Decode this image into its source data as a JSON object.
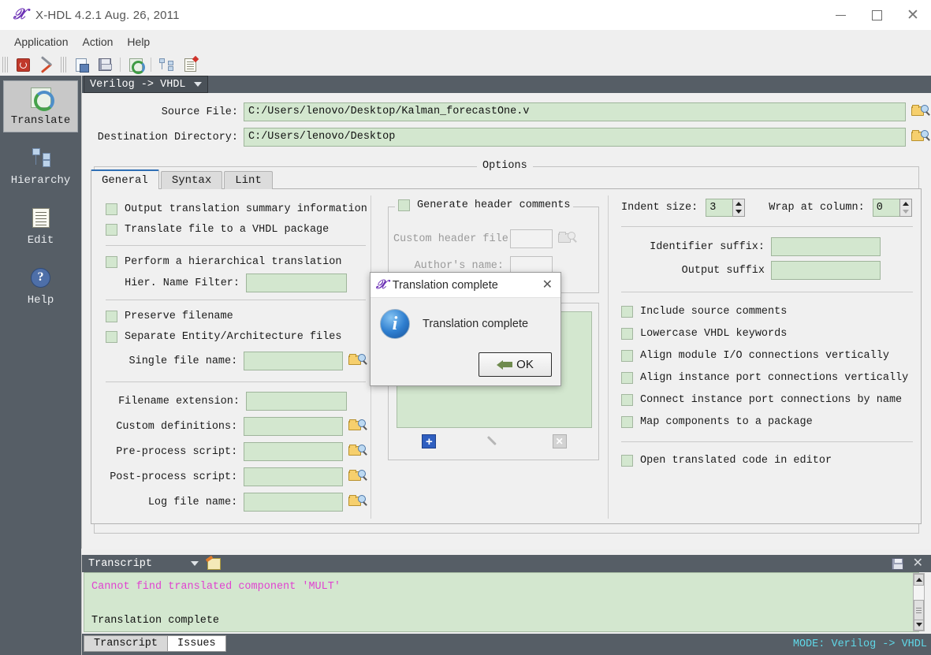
{
  "window": {
    "title": "X-HDL 4.2.1  Aug. 26, 2011",
    "app_icon": "x-hdl-logo-icon",
    "minimize": "minimize-icon",
    "maximize": "maximize-icon",
    "close": "close-icon"
  },
  "menubar": {
    "items": [
      "Application",
      "Action",
      "Help"
    ]
  },
  "toolbar": {
    "icons": [
      "exit-icon",
      "tools-icon",
      "save-as-icon",
      "save-icon",
      "translate-icon",
      "hierarchy-icon",
      "edit-icon"
    ]
  },
  "sidebar": {
    "items": [
      {
        "label": "Translate",
        "icon": "translate-icon",
        "selected": true
      },
      {
        "label": "Hierarchy",
        "icon": "hierarchy-icon",
        "selected": false
      },
      {
        "label": "Edit",
        "icon": "edit-icon",
        "selected": false
      },
      {
        "label": "Help",
        "icon": "help-icon",
        "selected": false
      }
    ]
  },
  "mode_selector": {
    "value": "Verilog -> VHDL"
  },
  "paths": {
    "source_label": "Source File:",
    "source_value": "C:/Users/lenovo/Desktop/Kalman_forecastOne.v",
    "dest_label": "Destination Directory:",
    "dest_value": "C:/Users/lenovo/Desktop"
  },
  "options": {
    "group_title": "Options",
    "tabs": [
      {
        "label": "General",
        "active": true
      },
      {
        "label": "Syntax",
        "active": false
      },
      {
        "label": "Lint",
        "active": false
      }
    ],
    "left_column": {
      "checks_top": [
        "Output translation summary information",
        "Translate file to a VHDL package"
      ],
      "hier_check": "Perform a hierarchical translation",
      "hier_filter_label": "Hier. Name Filter:",
      "hier_filter_value": "",
      "checks_mid": [
        "Preserve filename",
        "Separate Entity/Architecture files"
      ],
      "single_file_label": "Single file name:",
      "single_file_value": "",
      "fields": [
        {
          "label": "Filename extension:",
          "value": "",
          "browse": false
        },
        {
          "label": "Custom definitions:",
          "value": "",
          "browse": true
        },
        {
          "label": "Pre-process script:",
          "value": "",
          "browse": true
        },
        {
          "label": "Post-process script:",
          "value": "",
          "browse": true
        },
        {
          "label": "Log file name:",
          "value": "",
          "browse": true
        }
      ]
    },
    "middle_column": {
      "header_group_label": "Generate header comments",
      "custom_header_label": "Custom header file:",
      "custom_header_value": "",
      "author_label": "Author's name:",
      "author_value": "",
      "list_items": [],
      "list_add": "add-icon",
      "list_edit": "edit-pencil-icon",
      "list_delete": "delete-icon"
    },
    "right_column": {
      "indent_label": "Indent size:",
      "indent_value": "3",
      "wrap_label": "Wrap at column:",
      "wrap_value": "0",
      "identifier_suffix_label": "Identifier suffix:",
      "identifier_suffix_value": "",
      "output_suffix_label": "Output suffix",
      "output_suffix_value": "",
      "checks": [
        "Include source comments",
        "Lowercase VHDL keywords",
        "Align module I/O connections vertically",
        "Align instance port connections vertically",
        "Connect instance port connections by name",
        "Map components to a package"
      ],
      "open_editor_check": "Open translated code in editor"
    }
  },
  "transcript": {
    "combo_value": "Transcript",
    "note_icon": "note-icon",
    "save_icon": "save-icon",
    "close_icon": "close-icon",
    "lines": [
      {
        "text": "Cannot find translated component 'MULT'",
        "kind": "error"
      },
      {
        "text": "",
        "kind": "blank"
      },
      {
        "text": "Translation complete",
        "kind": "normal"
      }
    ],
    "tabs": [
      {
        "label": "Transcript",
        "active": true
      },
      {
        "label": "Issues",
        "active": false
      }
    ],
    "status": "MODE: Verilog -> VHDL"
  },
  "dialog": {
    "title": "Translation complete",
    "app_icon": "x-hdl-logo-icon",
    "close": "close-icon",
    "info_icon": "info-icon",
    "message": "Translation complete",
    "ok_label": "OK",
    "ok_icon": "enter-arrow-icon"
  },
  "colors": {
    "field_green": "#d3e7cf",
    "sidebar_dark": "#565e66",
    "accent_blue": "#2f6fb5",
    "error_pink": "#e043d0",
    "status_cyan": "#5fd8e8"
  }
}
